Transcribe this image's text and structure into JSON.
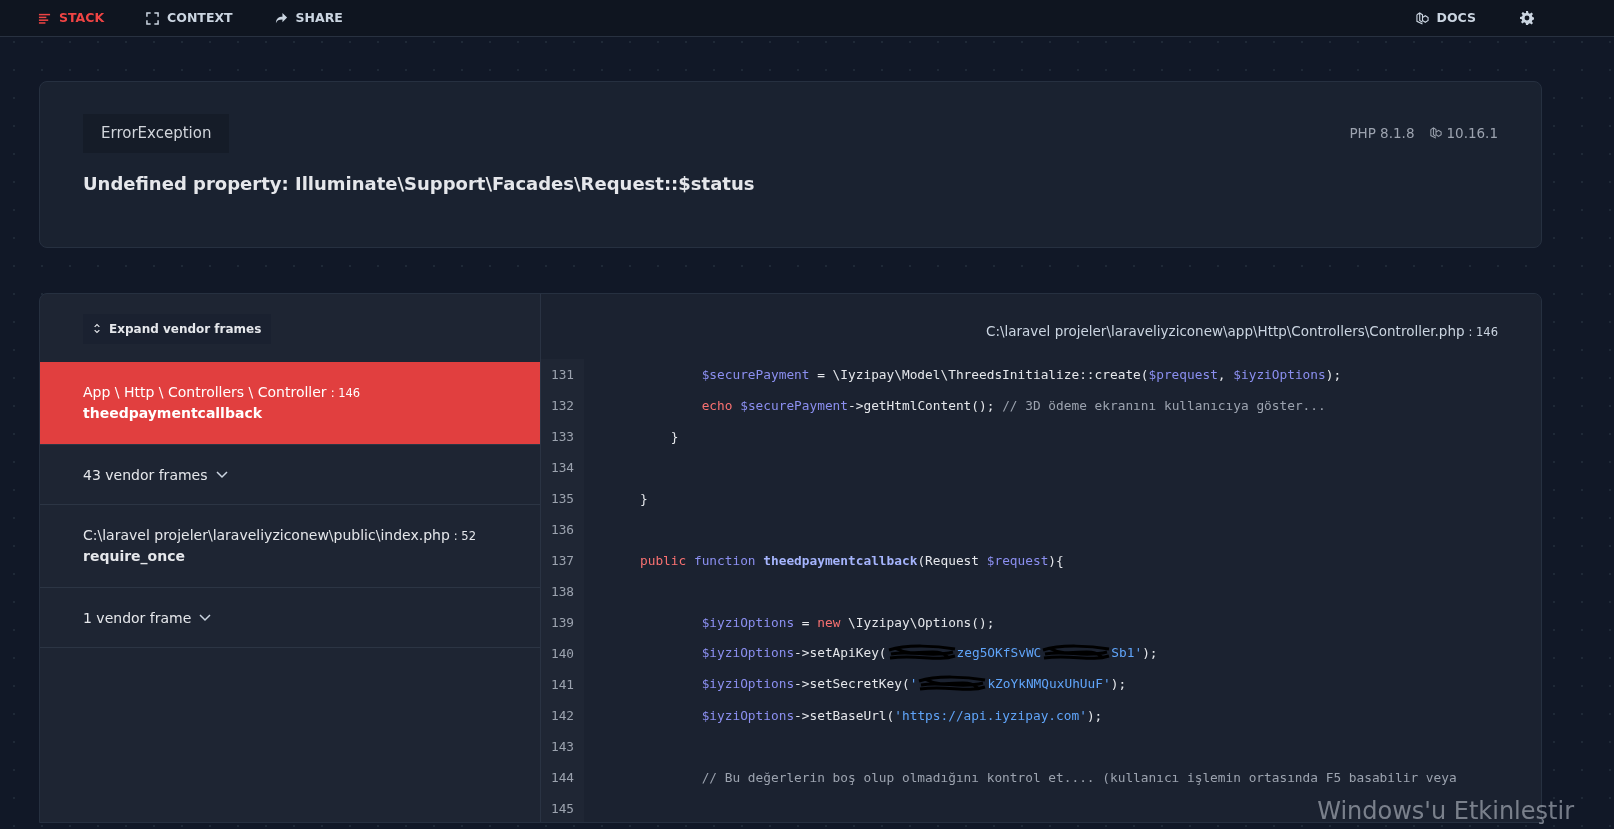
{
  "nav": {
    "left": [
      {
        "label": "STACK",
        "selected": true
      },
      {
        "label": "CONTEXT",
        "selected": false
      },
      {
        "label": "SHARE",
        "selected": false
      }
    ],
    "right": [
      {
        "label": "DOCS"
      }
    ]
  },
  "error": {
    "type": "ErrorException",
    "message": "Undefined property: Illuminate\\Support\\Facades\\Request::$status",
    "php": "PHP 8.1.8",
    "laravel": "10.16.1"
  },
  "stack": {
    "expand_button": "Expand vendor frames",
    "frames": [
      {
        "kind": "frame",
        "selected": true,
        "file": "App \\ Http \\ Controllers \\ Controller",
        "line": ": 146",
        "method": "theedpaymentcallback"
      },
      {
        "kind": "vendor",
        "selected": false,
        "label": "43 vendor frames"
      },
      {
        "kind": "frame",
        "selected": false,
        "file": "C:\\laravel projeler\\laraveliyziconew\\public\\index.php",
        "line": ": 52",
        "method": "require_once"
      },
      {
        "kind": "vendor",
        "selected": false,
        "label": "1 vendor frame"
      }
    ]
  },
  "code": {
    "file": "C:\\laravel projeler\\laraveliyziconew\\app\\Http\\Controllers\\Controller.php",
    "line": ": 146",
    "lines": [
      {
        "number": "131",
        "tokens": [
          {
            "kind": "var",
            "text": "        $securePayment"
          },
          {
            "kind": "plain",
            "text": " = \\Iyzipay\\Model\\ThreedsInitialize::create("
          },
          {
            "kind": "var",
            "text": "$prequest"
          },
          {
            "kind": "plain",
            "text": ", "
          },
          {
            "kind": "var",
            "text": "$iyziOptions"
          },
          {
            "kind": "plain",
            "text": ");"
          }
        ]
      },
      {
        "number": "132",
        "tokens": [
          {
            "kind": "kw",
            "text": "        echo "
          },
          {
            "kind": "var",
            "text": "$securePayment"
          },
          {
            "kind": "plain",
            "text": "->getHtmlContent(); "
          },
          {
            "kind": "cmt",
            "text": "// 3D ödeme ekranını kullanıcıya göster..."
          }
        ]
      },
      {
        "number": "133",
        "tokens": [
          {
            "kind": "plain",
            "text": "    }"
          }
        ]
      },
      {
        "number": "134"
      },
      {
        "number": "135",
        "tokens": [
          {
            "kind": "plain",
            "text": "}"
          }
        ]
      },
      {
        "number": "136"
      },
      {
        "number": "137",
        "tokens": [
          {
            "kind": "kw",
            "text": "public "
          },
          {
            "kind": "kw2",
            "text": "function "
          },
          {
            "kind": "fn",
            "text": "theedpaymentcallback"
          },
          {
            "kind": "plain",
            "text": "(Request "
          },
          {
            "kind": "var",
            "text": "$request"
          },
          {
            "kind": "plain",
            "text": "){"
          }
        ]
      },
      {
        "number": "138"
      },
      {
        "number": "139",
        "tokens": [
          {
            "kind": "var",
            "text": "        $iyziOptions"
          },
          {
            "kind": "plain",
            "text": " = "
          },
          {
            "kind": "kw",
            "text": "new"
          },
          {
            "kind": "plain",
            "text": " \\Iyzipay\\Options();"
          }
        ]
      },
      {
        "number": "140",
        "tokens": [
          {
            "kind": "var",
            "text": "        $iyziOptions"
          },
          {
            "kind": "plain",
            "text": "->setApiKey("
          },
          {
            "kind": "scribble"
          },
          {
            "kind": "str",
            "text": "zeg5OKfSvWC"
          },
          {
            "kind": "scribble"
          },
          {
            "kind": "str",
            "text": "Sb1'"
          },
          {
            "kind": "plain",
            "text": ");"
          }
        ]
      },
      {
        "number": "141",
        "tokens": [
          {
            "kind": "var",
            "text": "        $iyziOptions"
          },
          {
            "kind": "plain",
            "text": "->setSecretKey("
          },
          {
            "kind": "str",
            "text": "'"
          },
          {
            "kind": "scribble"
          },
          {
            "kind": "str",
            "text": "kZoYkNMQuxUhUuF'"
          },
          {
            "kind": "plain",
            "text": ");"
          }
        ]
      },
      {
        "number": "142",
        "tokens": [
          {
            "kind": "var",
            "text": "        $iyziOptions"
          },
          {
            "kind": "plain",
            "text": "->setBaseUrl("
          },
          {
            "kind": "str",
            "text": "'https://api.iyzipay.com'"
          },
          {
            "kind": "plain",
            "text": ");"
          }
        ]
      },
      {
        "number": "143"
      },
      {
        "number": "144",
        "tokens": [
          {
            "kind": "cmt",
            "text": "        // Bu değerlerin boş olup olmadığını kontrol et.... (kullanıcı işlemin ortasında F5 basabilir veya"
          }
        ]
      },
      {
        "number": "145"
      }
    ]
  },
  "os_notice": "Windows'u Etkinleştir"
}
